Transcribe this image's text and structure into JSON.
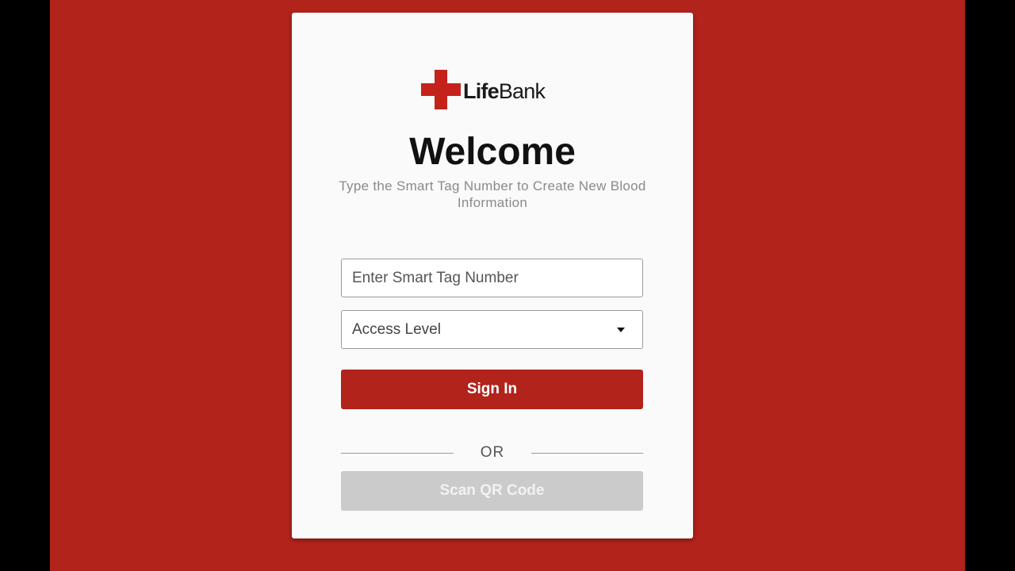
{
  "brand": {
    "name_bold": "Life",
    "name_regular": "Bank",
    "logo_color": "#c4231c"
  },
  "login": {
    "title": "Welcome",
    "subtitle": "Type the Smart Tag Number to Create New Blood Information",
    "smart_tag_placeholder": "Enter Smart Tag Number",
    "smart_tag_value": "",
    "access_level_label": "Access Level",
    "sign_in_label": "Sign In",
    "divider_text": "OR",
    "scan_qr_label": "Scan QR Code"
  },
  "colors": {
    "background": "#b1231b",
    "card": "#fafafa",
    "primary_button": "#b1231b",
    "disabled_button": "#cbcbcb"
  },
  "icons": {
    "logo": "red-cross-icon",
    "dropdown": "caret-down-icon"
  }
}
